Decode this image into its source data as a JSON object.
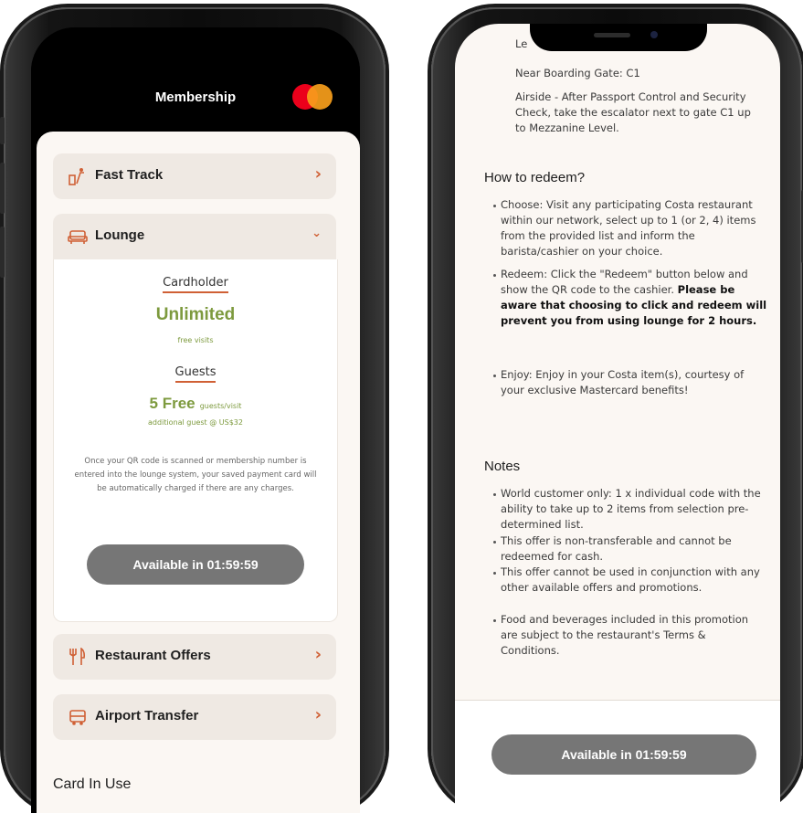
{
  "left": {
    "header_title": "Membership",
    "brand_colors": {
      "red": "#eb001b",
      "yellow": "#f79e1b",
      "accent": "#d06035"
    },
    "items": {
      "fast_track": "Fast Track",
      "lounge": "Lounge",
      "restaurant": "Restaurant Offers",
      "transfer": "Airport Transfer"
    },
    "lounge": {
      "cardholder_label": "Cardholder",
      "cardholder_value": "Unlimited",
      "cardholder_sub": "free visits",
      "guests_label": "Guests",
      "guests_value": "5 Free",
      "guests_unit": "guests/visit",
      "guests_extra": "additional guest @ US$32",
      "notice": "Once your QR code is scanned or membership number is entered into the lounge system, your saved payment card will be automatically charged if there are any charges.",
      "button": "Available in 01:59:59"
    },
    "card_in_use": "Card In Use"
  },
  "right": {
    "loc_clip": "Le",
    "loc_gate": "Near Boarding Gate: C1",
    "loc_directions": "Airside - After Passport Control and Security Check, take the escalator next to gate C1 up to Mezzanine Level.",
    "redeem_title": "How to redeem?",
    "redeem": {
      "choose": "Choose: Visit any participating Costa restaurant within our network, select up to 1 (or 2, 4) items from the provided list and inform the barista/cashier on your choice.",
      "redeem": "Redeem: Click the \"Redeem\" button below and show the QR code to the cashier.",
      "redeem_bold": "Please be aware that choosing to click and redeem will prevent you from using lounge for 2 hours.",
      "enjoy": "Enjoy: Enjoy in your Costa item(s), courtesy of your exclusive Mastercard benefits!"
    },
    "notes_title": "Notes",
    "notes": [
      "World customer only: 1 x individual code with the ability to take up to 2 items from selection pre-determined list.",
      "This offer is non-transferable and cannot be redeemed for cash.",
      "This offer cannot be used in conjunction with any other available offers and promotions.",
      "Food and beverages included in this promotion are subject to the restaurant's Terms & Conditions."
    ],
    "button": "Available in 01:59:59"
  }
}
